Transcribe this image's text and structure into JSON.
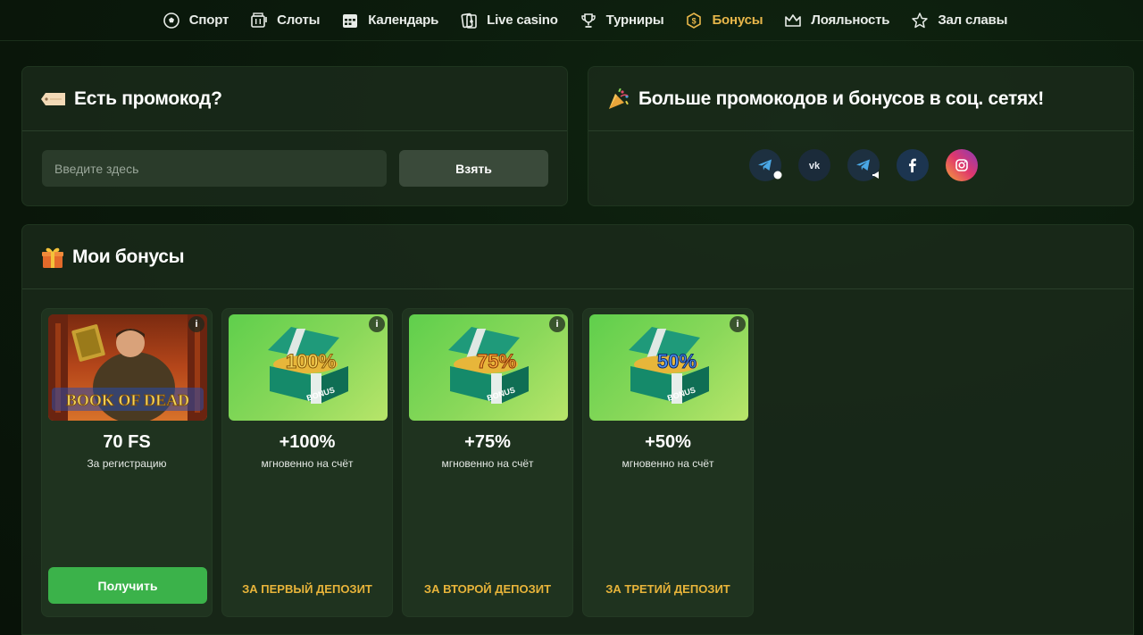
{
  "nav": {
    "items": [
      {
        "label": "Спорт",
        "icon": "soccer-ball-icon"
      },
      {
        "label": "Слоты",
        "icon": "slot-machine-icon"
      },
      {
        "label": "Календарь",
        "icon": "calendar-icon"
      },
      {
        "label": "Live casino",
        "icon": "cards-icon"
      },
      {
        "label": "Турниры",
        "icon": "trophy-icon"
      },
      {
        "label": "Бонусы",
        "icon": "coin-icon",
        "active": true
      },
      {
        "label": "Лояльность",
        "icon": "crown-icon"
      },
      {
        "label": "Зал славы",
        "icon": "star-icon"
      }
    ],
    "active_color": "#e7b64a"
  },
  "promo": {
    "title": "Есть промокод?",
    "icon": "ticket-icon",
    "placeholder": "Введите здесь",
    "button_label": "Взять"
  },
  "social": {
    "title": "Больше промокодов и бонусов в соц. сетях!",
    "icon": "party-popper-icon",
    "networks": [
      "telegram-chat-icon",
      "vk-icon",
      "telegram-channel-icon",
      "facebook-icon",
      "instagram-icon"
    ]
  },
  "bonuses": {
    "title": "Мои бонусы",
    "icon": "gift-icon",
    "cards": [
      {
        "image": "book-of-dead-image",
        "image_text": "BOOK OF DEAD",
        "value": "70 FS",
        "subtitle": "За регистрацию",
        "button_label": "Получить",
        "info": "i"
      },
      {
        "image": "chest-100-image",
        "badge": "100%",
        "chest_label": "BONUS",
        "value": "+100%",
        "subtitle": "мгновенно на счёт",
        "footer": "ЗА ПЕРВЫЙ ДЕПОЗИТ",
        "info": "i",
        "badge_color": "#f3d35a"
      },
      {
        "image": "chest-75-image",
        "badge": "75%",
        "chest_label": "BONUS",
        "value": "+75%",
        "subtitle": "мгновенно на счёт",
        "footer": "ЗА ВТОРОЙ ДЕПОЗИТ",
        "info": "i",
        "badge_color": "#f5a63a"
      },
      {
        "image": "chest-50-image",
        "badge": "50%",
        "chest_label": "BONUS",
        "value": "+50%",
        "subtitle": "мгновенно на счёт",
        "footer": "ЗА ТРЕТИЙ ДЕПОЗИТ",
        "info": "i",
        "badge_color": "#4f8ff0"
      }
    ],
    "footer_color": "#e8b43a",
    "button_color": "#3bb24a"
  }
}
